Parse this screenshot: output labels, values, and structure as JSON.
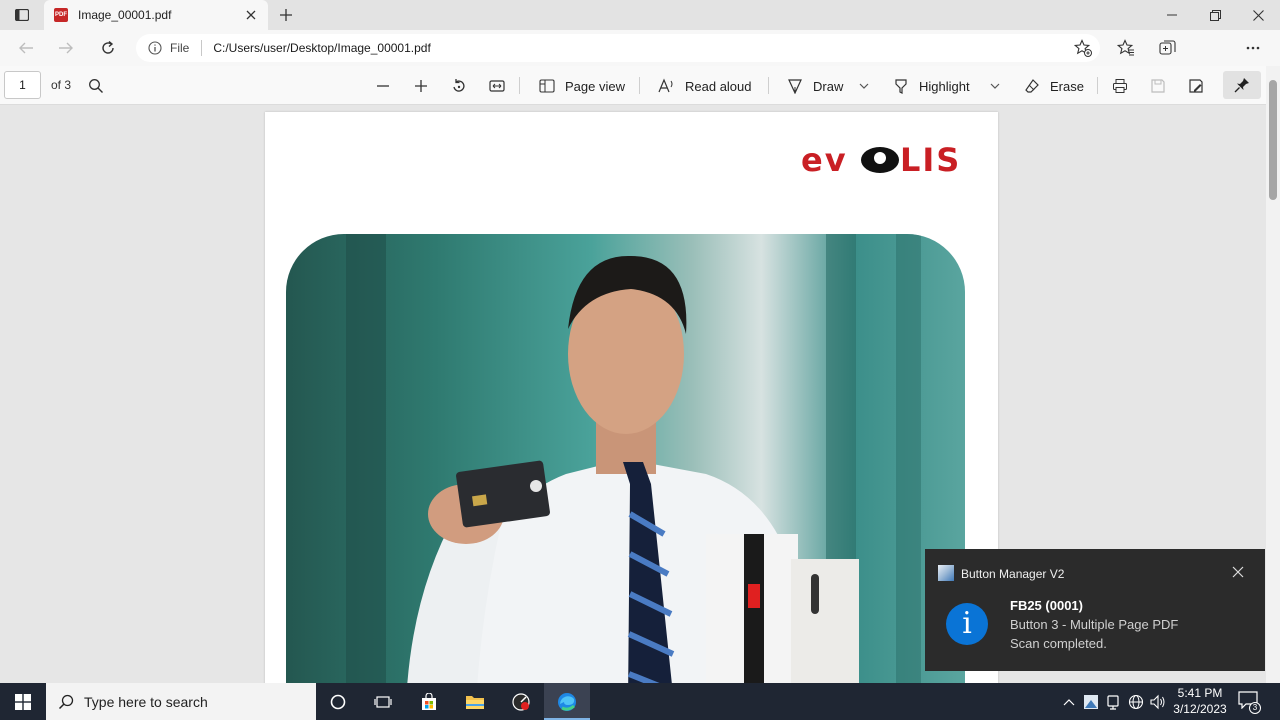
{
  "browser": {
    "tab_title": "Image_00001.pdf",
    "pdf_badge": "PDF",
    "address_scheme": "File",
    "address_url": "C:/Users/user/Desktop/Image_00001.pdf"
  },
  "pdf_toolbar": {
    "page_number": "1",
    "page_total": "of 3",
    "page_view_label": "Page view",
    "read_aloud_label": "Read aloud",
    "draw_label": "Draw",
    "highlight_label": "Highlight",
    "erase_label": "Erase"
  },
  "document": {
    "logo_text": "EVOLIS"
  },
  "toast": {
    "app_name": "Button Manager V2",
    "title": "FB25 (0001)",
    "line1": "Button 3 - Multiple Page PDF",
    "line2": "Scan completed.",
    "info_glyph": "i"
  },
  "taskbar": {
    "search_placeholder": "Type here to search",
    "time": "5:41 PM",
    "date": "3/12/2023",
    "notification_count": "3"
  },
  "colors": {
    "logo_red": "#c91f24",
    "toast_bg": "#2b2b2b",
    "info_blue": "#0a74d6",
    "taskbar_bg": "#1f2633"
  },
  "icons": [
    "tab-actions-icon",
    "pdf-icon",
    "close-icon",
    "plus-icon",
    "minimize-icon",
    "restore-icon",
    "back-icon",
    "forward-icon",
    "refresh-icon",
    "info-icon",
    "add-favorite-icon",
    "favorites-icon",
    "collections-icon",
    "more-icon",
    "search-icon",
    "zoom-out-icon",
    "zoom-in-icon",
    "rotate-icon",
    "fit-icon",
    "page-view-icon",
    "read-aloud-icon",
    "draw-icon",
    "chevron-down-icon",
    "highlight-icon",
    "erase-icon",
    "print-icon",
    "save-icon",
    "save-as-icon",
    "pin-icon",
    "windows-icon",
    "cortana-icon",
    "task-view-icon",
    "store-icon",
    "file-explorer-icon",
    "app-icon",
    "edge-icon",
    "chevron-up-icon",
    "network-icon",
    "volume-icon",
    "notification-icon"
  ]
}
